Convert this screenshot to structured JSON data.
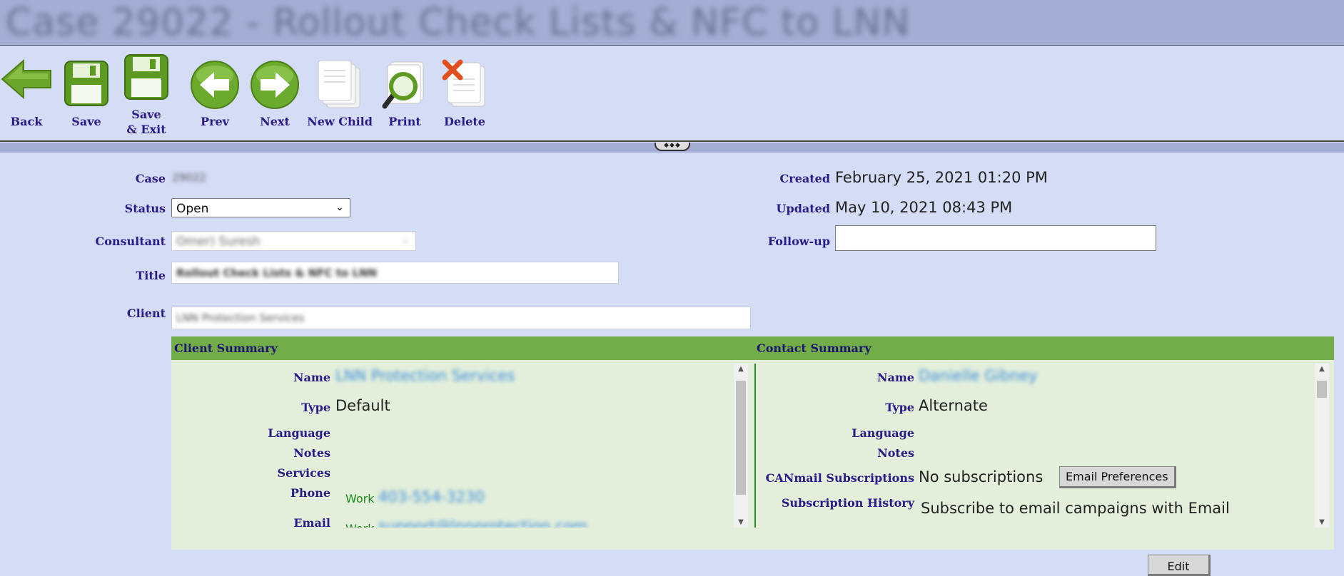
{
  "page": {
    "title": "Case 29022 - Rollout Check Lists & NFC to LNN"
  },
  "toolbar": {
    "back": "Back",
    "save": "Save",
    "save_exit": "Save & Exit",
    "prev": "Prev",
    "next": "Next",
    "new_child": "New Child",
    "print": "Print",
    "delete": "Delete"
  },
  "case": {
    "case_label": "Case",
    "case_value": "29022",
    "status_label": "Status",
    "status_value": "Open",
    "consultant_label": "Consultant",
    "consultant_value": "Omer) Suresh",
    "title_label": "Title",
    "title_value": "Rollout Check Lists & NFC to LNN",
    "client_label": "Client",
    "client_value": "LNN Protection Services",
    "created_label": "Created",
    "created_value": "February 25, 2021 01:20 PM",
    "updated_label": "Updated",
    "updated_value": "May 10, 2021 08:43 PM",
    "followup_label": "Follow-up",
    "followup_value": ""
  },
  "client_summary": {
    "heading": "Client Summary",
    "name_label": "Name",
    "name_value": "LNN Protection Services",
    "type_label": "Type",
    "type_value": "Default",
    "language_label": "Language",
    "notes_label": "Notes",
    "services_label": "Services",
    "phone_label": "Phone",
    "phone_kind": "Work",
    "phone_value": "403-554-3230",
    "email_label": "Email",
    "email_kind": "Work",
    "email_value": "support@lnnprotection.com"
  },
  "contact_summary": {
    "heading": "Contact Summary",
    "name_label": "Name",
    "name_value": "Danielle Gibney",
    "type_label": "Type",
    "type_value": "Alternate",
    "language_label": "Language",
    "notes_label": "Notes",
    "canmail_label": "CANmail Subscriptions",
    "canmail_value": "No subscriptions",
    "email_prefs_button": "Email Preferences",
    "history_label": "Subscription History",
    "history_value": "Subscribe to email campaigns with Email"
  },
  "footer": {
    "edit_button": "Edit"
  }
}
